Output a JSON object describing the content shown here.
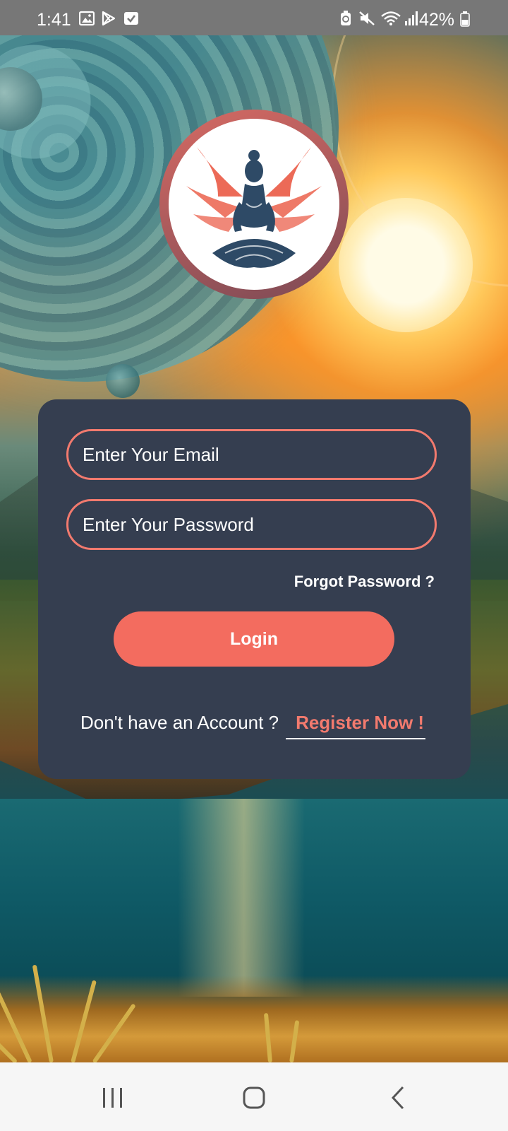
{
  "status_bar": {
    "time": "1:41",
    "battery": "42%",
    "left_icons": [
      "gallery-icon",
      "play-store-icon",
      "checkbox-icon"
    ],
    "right_icons": [
      "battery-saver-icon",
      "mute-icon",
      "wifi-icon",
      "signal-icon",
      "battery-icon"
    ]
  },
  "logo": {
    "description_icon": "meditating-angel-icon",
    "ring_color": "#d66a63"
  },
  "login_form": {
    "email_placeholder": "Enter Your Email",
    "email_value": "",
    "password_placeholder": "Enter Your Password",
    "password_value": "",
    "forgot_label": "Forgot Password ?",
    "login_label": "Login",
    "no_account_text": "Don't have an Account ?",
    "register_label": "Register Now !"
  },
  "colors": {
    "accent": "#f36c5f",
    "card": "#353e50",
    "field_border": "#f27a6e"
  },
  "nav_bar": {
    "buttons": [
      "recent-apps-icon",
      "home-icon",
      "back-icon"
    ]
  }
}
